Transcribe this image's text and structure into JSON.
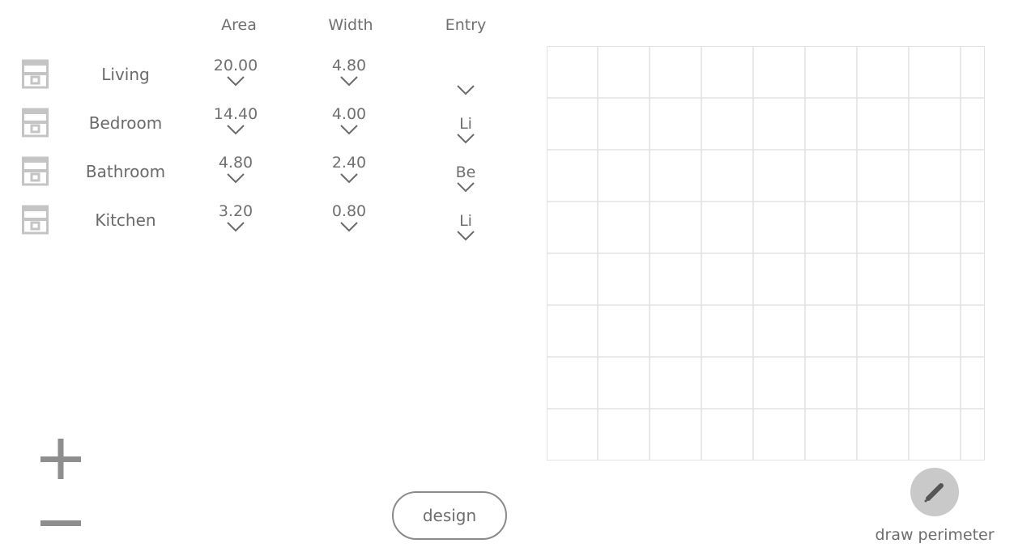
{
  "headers": {
    "area": "Area",
    "width": "Width",
    "entry": "Entry"
  },
  "rooms": [
    {
      "name": "Living",
      "area": "20.00",
      "width": "4.80",
      "entry": ""
    },
    {
      "name": "Bedroom",
      "area": "14.40",
      "width": "4.00",
      "entry": "Li"
    },
    {
      "name": "Bathroom",
      "area": "4.80",
      "width": "2.40",
      "entry": "Be"
    },
    {
      "name": "Kitchen",
      "area": "3.20",
      "width": "0.80",
      "entry": "Li"
    }
  ],
  "icons": {
    "room": "room-icon",
    "dropdown": "chevron-down-icon",
    "add": "plus-icon",
    "remove": "minus-icon",
    "draw": "pencil-icon"
  },
  "actions": {
    "design_label": "design",
    "draw_perimeter_label": "draw perimeter"
  },
  "colors": {
    "text": "#707070",
    "icon_gray": "#c4c4c4",
    "grid_line": "#e2e2e2",
    "button_border": "#8a8a8a",
    "draw_button_bg": "#c9c9c9"
  }
}
